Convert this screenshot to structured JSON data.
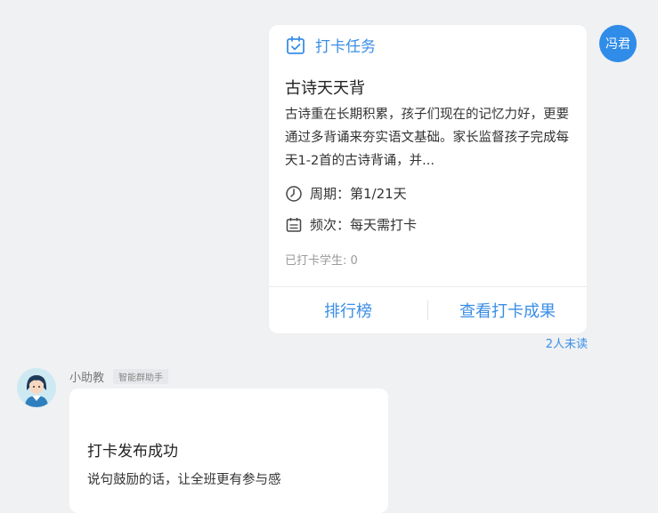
{
  "task_card": {
    "header_label": "打卡任务",
    "title": "古诗天天背",
    "description": "古诗重在长期积累，孩子们现在的记忆力好，更要通过多背诵来夯实语文基础。家长监督孩子完成每天1-2首的古诗背诵，并...",
    "period": "周期：第1/21天",
    "frequency": "频次：每天需打卡",
    "checked_in": "已打卡学生: 0",
    "ranking_button": "排行榜",
    "results_button": "查看打卡成果",
    "accent_color": "#3a8ee6",
    "icons": {
      "header": "calendar-check-icon",
      "period": "clock-icon",
      "frequency": "calendar-list-icon"
    }
  },
  "sender_avatar": {
    "text": "冯君",
    "color": "#2f8ce8"
  },
  "unread_status": "2人未读",
  "assistant": {
    "name": "小助教",
    "tag": "智能群助手",
    "avatar_icon": "assistant-avatar-icon"
  },
  "success_card": {
    "title": "打卡发布成功",
    "description": "说句鼓励的话，让全班更有参与感"
  }
}
